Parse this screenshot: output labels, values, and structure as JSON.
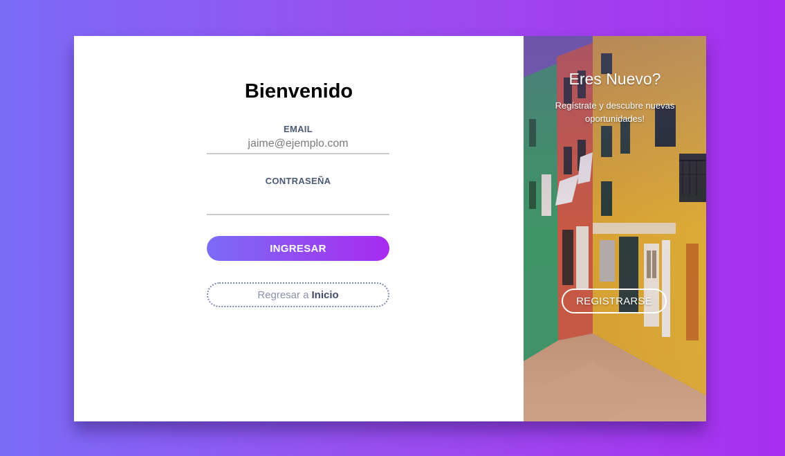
{
  "login": {
    "title": "Bienvenido",
    "email_label": "EMAIL",
    "email_placeholder": "jaime@ejemplo.com",
    "email_value": "",
    "password_label": "CONTRASEÑA",
    "password_value": "",
    "submit_label": "INGRESAR",
    "back_prefix": "Regresar a",
    "back_link": "Inicio"
  },
  "signup_panel": {
    "title": "Eres Nuevo?",
    "text": "Regístrate y descubre nuevas oportunidades!",
    "button_label": "REGISTRARSE",
    "background_image": "colorful-houses-street-photo"
  },
  "colors": {
    "gradient_start": "#7b6cf6",
    "gradient_end": "#a82bef",
    "label_color": "#4b5a73",
    "card_background": "#ffffff"
  }
}
